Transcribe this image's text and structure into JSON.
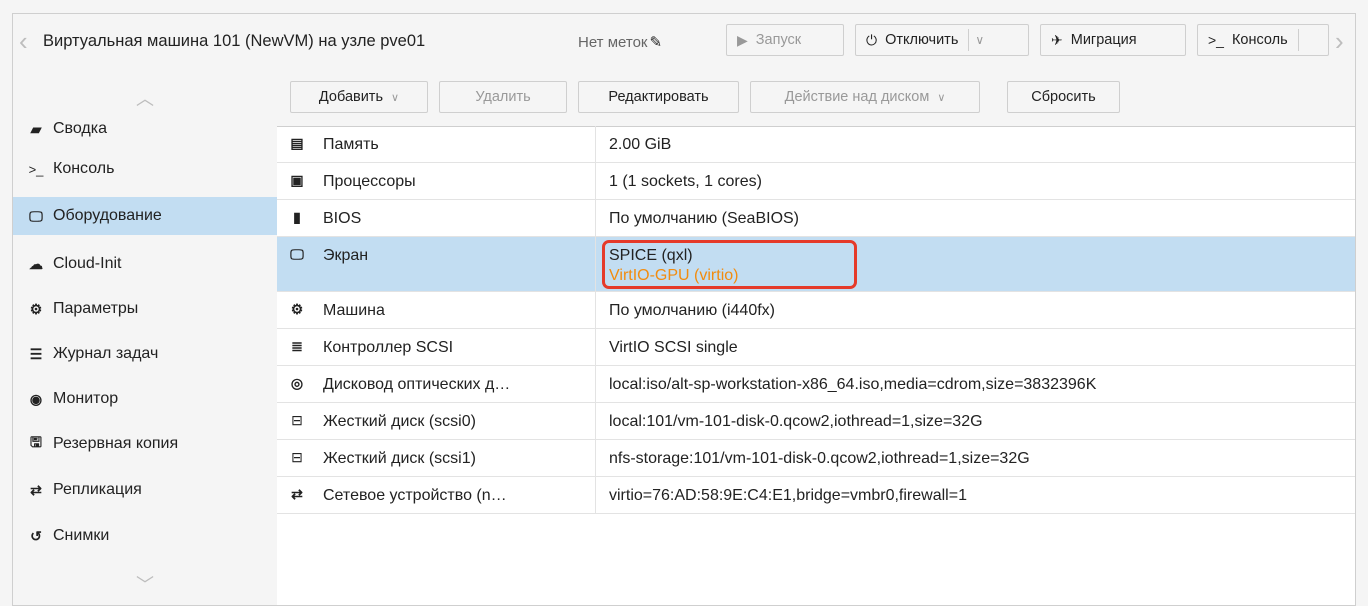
{
  "header": {
    "title": "Виртуальная машина 101 (NewVM) на узле pve01",
    "tags_label": "Нет меток",
    "buttons": {
      "start": "Запуск",
      "shutdown": "Отключить",
      "migrate": "Миграция",
      "console": "Консоль"
    }
  },
  "sidebar": {
    "items": [
      {
        "label": "Сводка",
        "icon": "summary-icon"
      },
      {
        "label": "Консоль",
        "icon": "terminal-icon"
      },
      {
        "label": "Оборудование",
        "icon": "monitor-icon"
      },
      {
        "label": "Cloud-Init",
        "icon": "cloud-icon"
      },
      {
        "label": "Параметры",
        "icon": "gear-icon"
      },
      {
        "label": "Журнал задач",
        "icon": "list-icon"
      },
      {
        "label": "Монитор",
        "icon": "eye-icon"
      },
      {
        "label": "Резервная копия",
        "icon": "floppy-icon"
      },
      {
        "label": "Репликация",
        "icon": "replication-icon"
      },
      {
        "label": "Снимки",
        "icon": "history-icon"
      }
    ],
    "active": "Оборудование"
  },
  "toolbar": {
    "add": "Добавить",
    "remove": "Удалить",
    "edit": "Редактировать",
    "disk_action": "Действие над диском",
    "reset": "Сбросить"
  },
  "hardware": {
    "rows": [
      {
        "key": "Память",
        "value": "2.00 GiB",
        "icon": "memory-icon"
      },
      {
        "key": "Процессоры",
        "value": "1 (1 sockets, 1 cores)",
        "icon": "cpu-icon"
      },
      {
        "key": "BIOS",
        "value": "По умолчанию (SeaBIOS)",
        "icon": "bios-icon"
      },
      {
        "key": "Экран",
        "value": "SPICE (qxl)",
        "pending_value": "VirtIO-GPU (virtio)",
        "icon": "display-icon"
      },
      {
        "key": "Машина",
        "value": "По умолчанию (i440fx)",
        "icon": "machine-icon"
      },
      {
        "key": "Контроллер SCSI",
        "value": "VirtIO SCSI single",
        "icon": "database-icon"
      },
      {
        "key": "Дисковод оптических д…",
        "value": "local:iso/alt-sp-workstation-x86_64.iso,media=cdrom,size=3832396K",
        "icon": "cdrom-icon"
      },
      {
        "key": "Жесткий диск (scsi0)",
        "value": "local:101/vm-101-disk-0.qcow2,iothread=1,size=32G",
        "icon": "hdd-icon"
      },
      {
        "key": "Жесткий диск (scsi1)",
        "value": "nfs-storage:101/vm-101-disk-0.qcow2,iothread=1,size=32G",
        "icon": "hdd-icon"
      },
      {
        "key": "Сетевое устройство (n…",
        "value": "virtio=76:AD:58:9E:C4:E1,bridge=vmbr0,firewall=1",
        "icon": "network-icon"
      }
    ],
    "selected": "Экран"
  },
  "colors": {
    "selected_bg": "#c2ddf2",
    "pending_text": "#f28c0f",
    "highlight_border": "#e53a2a"
  }
}
